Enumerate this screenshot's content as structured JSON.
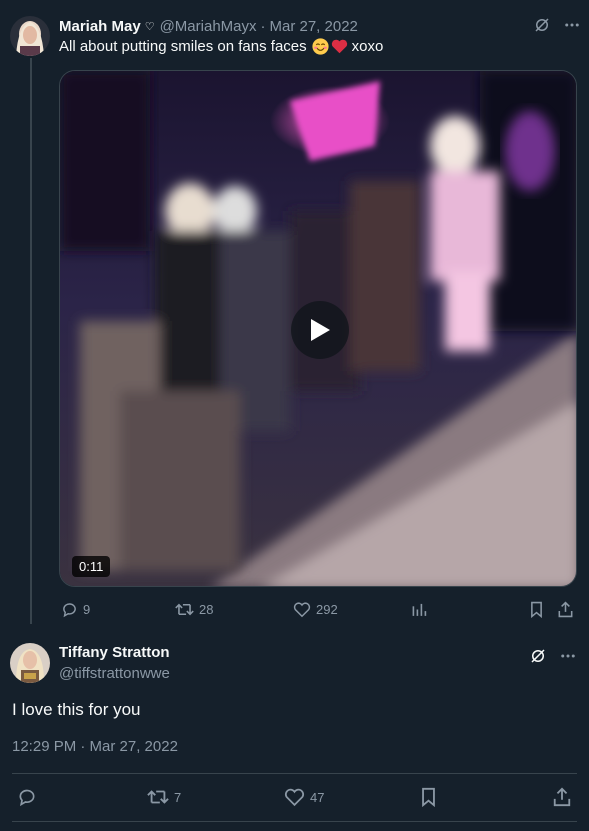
{
  "parent_tweet": {
    "author_name": "Mariah May",
    "author_badge": "♡",
    "handle": "@MariahMayx",
    "date": "Mar 27, 2022",
    "text": "All about putting smiles on fans faces",
    "text_suffix": "xoxo",
    "emojis": [
      "smiling-face-icon",
      "red-heart-icon"
    ],
    "video_duration": "0:11",
    "stats": {
      "replies": "9",
      "retweets": "28",
      "likes": "292"
    }
  },
  "main_tweet": {
    "author_name": "Tiffany Stratton",
    "handle": "@tiffstrattonwwe",
    "text": "I love this for you",
    "timestamp": "12:29 PM · Mar 27, 2022",
    "stats": {
      "retweets": "7",
      "likes": "47"
    }
  },
  "colors": {
    "background": "#15202b",
    "text": "#f7f9f9",
    "muted": "#8b98a5",
    "border": "#38444d"
  }
}
